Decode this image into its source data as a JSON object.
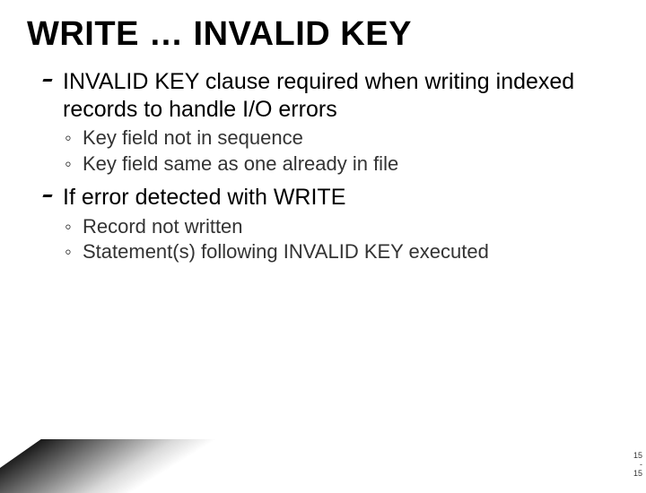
{
  "title": "WRITE … INVALID KEY",
  "bullets": [
    {
      "text": "INVALID KEY clause required when writing indexed records to handle I/O errors",
      "sub": [
        "Key field not in sequence",
        "Key field same as one already in file"
      ]
    },
    {
      "text": "If error detected with WRITE",
      "sub": [
        "Record not written",
        "Statement(s) following INVALID KEY executed"
      ]
    }
  ],
  "page": {
    "top": "15",
    "mid": "-",
    "bot": "15"
  }
}
